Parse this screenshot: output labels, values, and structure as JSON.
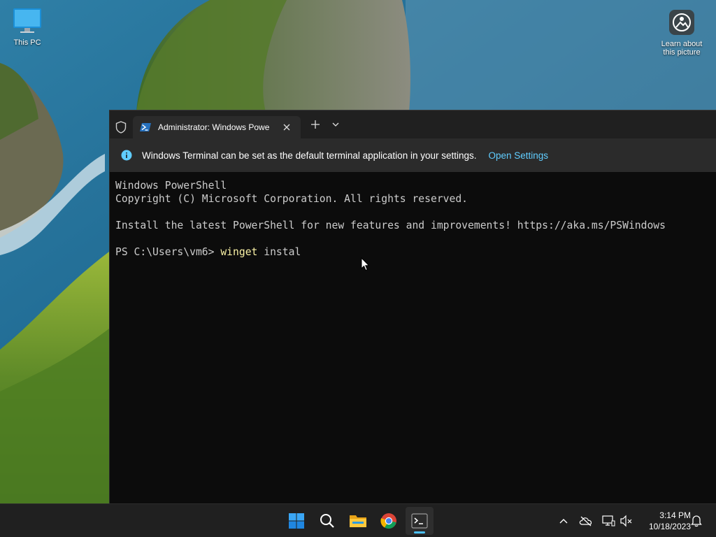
{
  "desktop": {
    "icons": {
      "this_pc": "This PC",
      "learn_line1": "Learn about",
      "learn_line2": "this picture"
    }
  },
  "terminal": {
    "tab": {
      "title": "Administrator: Windows Powe",
      "icon": "powershell-icon"
    },
    "infobar": {
      "message": "Windows Terminal can be set as the default terminal application in your settings.",
      "link": "Open Settings"
    },
    "console": {
      "line1": "Windows PowerShell",
      "line2": "Copyright (C) Microsoft Corporation. All rights reserved.",
      "line3": "",
      "line4": "Install the latest PowerShell for new features and improvements! https://aka.ms/PSWindows",
      "line5": "",
      "prompt": "PS C:\\Users\\vm6> ",
      "command": "winget",
      "args": " instal"
    },
    "colors": {
      "background": "#0c0c0c",
      "text": "#cccccc",
      "command": "#f9f1a5",
      "link": "#60cdff"
    }
  },
  "taskbar": {
    "apps": [
      "start-icon",
      "search-icon",
      "file-explorer-icon",
      "chrome-icon",
      "terminal-icon"
    ],
    "active_app": "terminal-icon",
    "clock": {
      "time": "3:14 PM",
      "date": "10/18/2023"
    },
    "accent": "#4cc2ff"
  }
}
